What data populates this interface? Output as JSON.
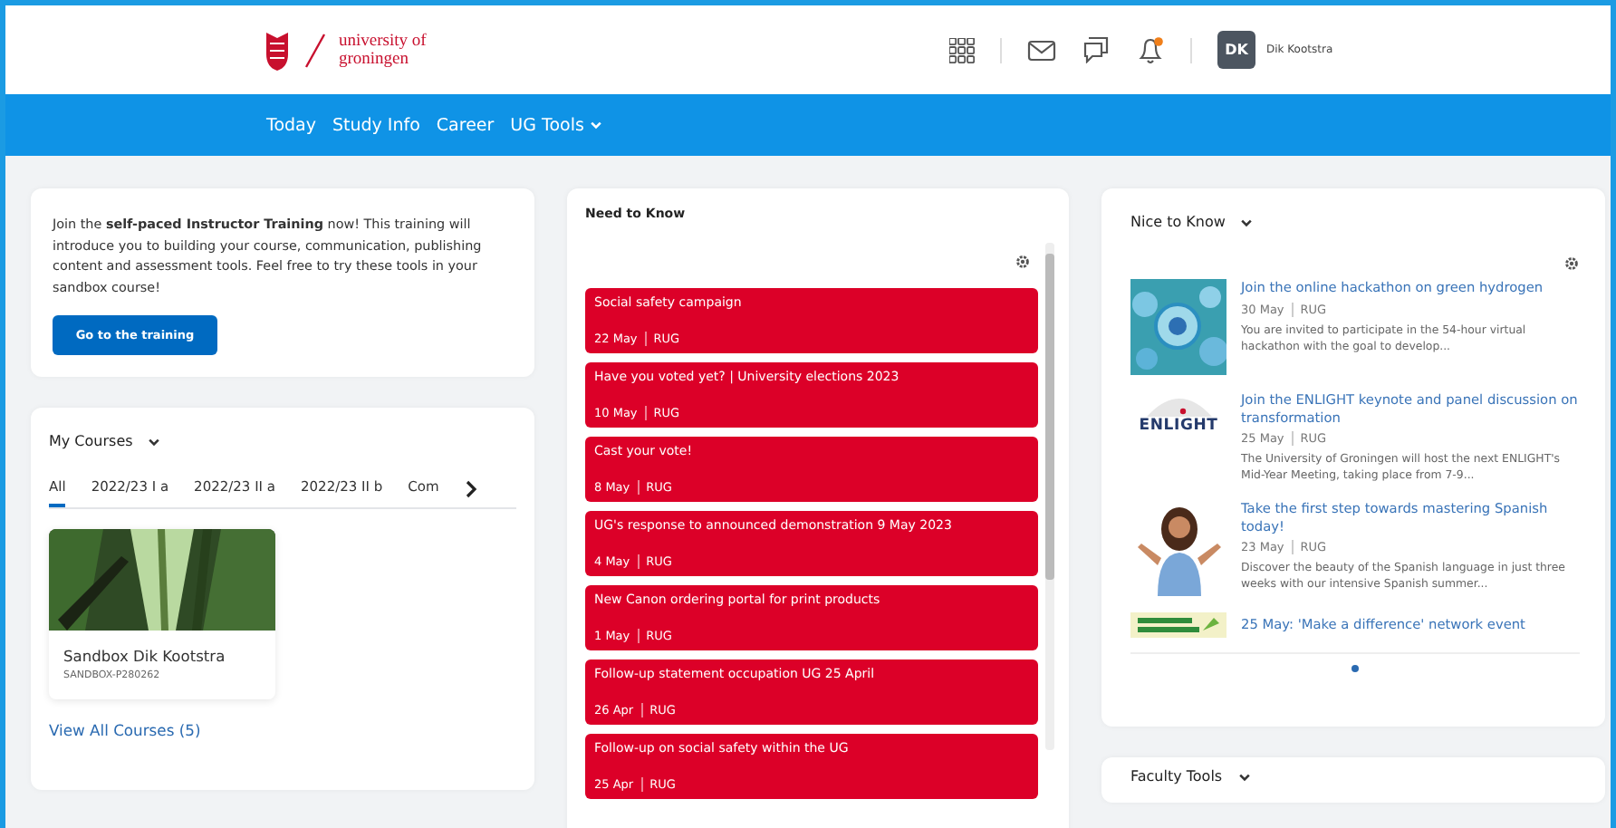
{
  "header": {
    "logo": {
      "line_1": "university of",
      "line_2": "groningen"
    },
    "notification_dot": true,
    "user": {
      "initials": "DK",
      "name": "Dik Kootstra"
    }
  },
  "nav": [
    {
      "label": "Today",
      "dropdown": false
    },
    {
      "label": "Study Info",
      "dropdown": false
    },
    {
      "label": "Career",
      "dropdown": false
    },
    {
      "label": "UG Tools",
      "dropdown": true
    }
  ],
  "training": {
    "text": "Join the **self-paced Instructor Training** now! This training will introduce you to building your course, communication, publishing content and assessment tools. Feel free to try these tools in your sandbox course!",
    "button": "Go to the training"
  },
  "my_courses": {
    "title": "My Courses",
    "tabs": [
      {
        "label": "All",
        "selected": true
      },
      {
        "label": "2022/23 I a",
        "selected": false
      },
      {
        "label": "2022/23 II a",
        "selected": false
      },
      {
        "label": "2022/23 II b",
        "selected": false
      },
      {
        "label": "Com",
        "selected": false
      }
    ],
    "courses": [
      {
        "name": "Sandbox Dik Kootstra",
        "code": "SANDBOX-P280262"
      }
    ],
    "view_all": "View All Courses (5)"
  },
  "need_to_know": {
    "title": "Need to Know",
    "items": [
      {
        "title": "Social safety campaign",
        "date": "22 May",
        "source": "RUG"
      },
      {
        "title": "Have you voted yet? | University elections 2023",
        "date": "10 May",
        "source": "RUG"
      },
      {
        "title": "Cast your vote!",
        "date": "8 May",
        "source": "RUG"
      },
      {
        "title": "UG's response to announced demonstration 9 May 2023",
        "date": "4 May",
        "source": "RUG"
      },
      {
        "title": "New Canon ordering portal for print products",
        "date": "1 May",
        "source": "RUG"
      },
      {
        "title": "Follow-up statement occupation UG 25 April",
        "date": "26 Apr",
        "source": "RUG"
      },
      {
        "title": "Follow-up on social safety within the UG",
        "date": "25 Apr",
        "source": "RUG"
      }
    ]
  },
  "nice_to_know": {
    "title": "Nice to Know",
    "items": [
      {
        "kind": "bubbles",
        "title": "Join the online hackathon on green hydrogen",
        "date": "30 May",
        "source": "RUG",
        "summary": "You are invited to participate in the 54-hour virtual hackathon with the goal to develop..."
      },
      {
        "kind": "logo",
        "logo_text": "ENLIGHT",
        "title": "Join the ENLIGHT keynote and panel discussion on transformation",
        "date": "25 May",
        "source": "RUG",
        "summary": "The University of Groningen will host the next ENLIGHT's Mid-Year Meeting, taking place from 7-9..."
      },
      {
        "kind": "person",
        "title": "Take the first step towards mastering Spanish today!",
        "date": "23 May",
        "source": "RUG",
        "summary": "Discover the beauty of the Spanish language in just three weeks with our intensive Spanish summer..."
      },
      {
        "kind": "banner",
        "title": "25 May: 'Make a difference' network event"
      }
    ]
  },
  "faculty_tools": {
    "title": "Faculty Tools"
  }
}
